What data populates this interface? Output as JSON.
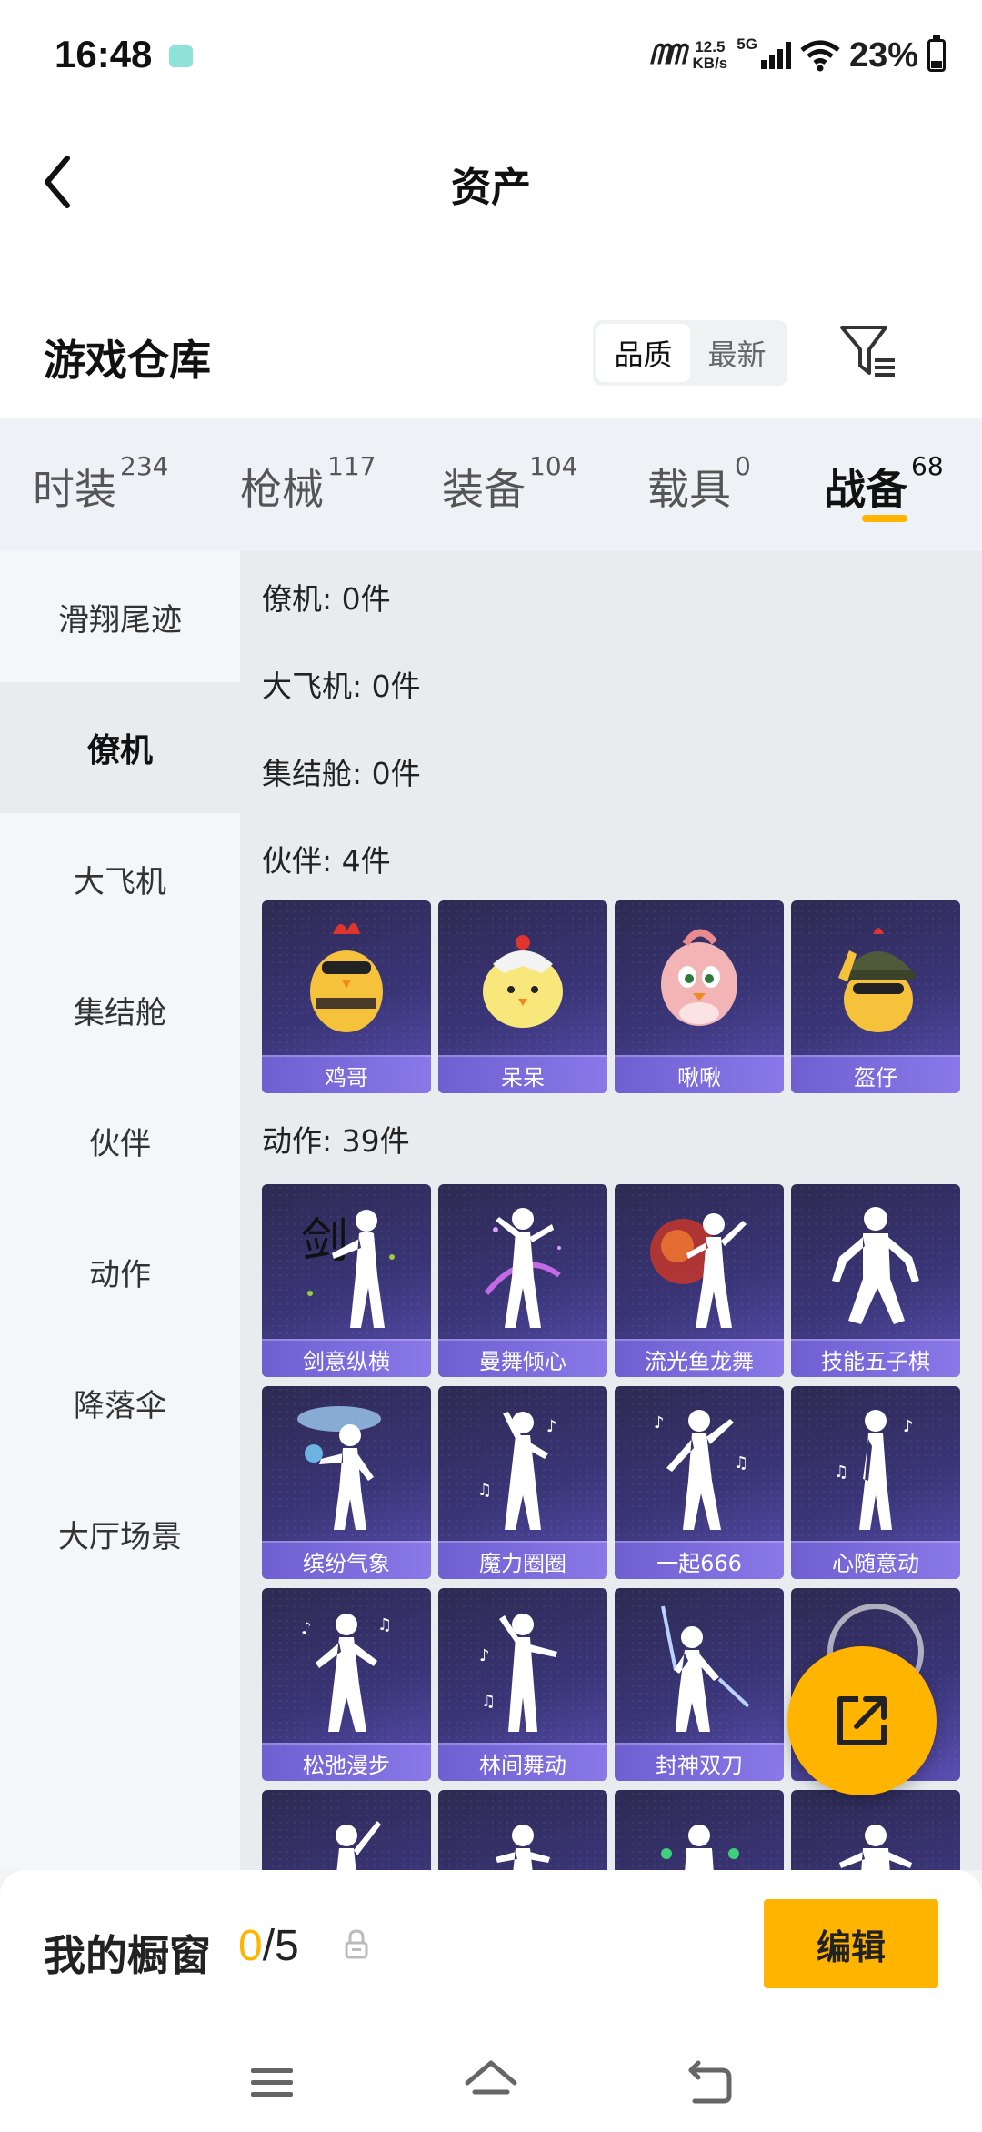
{
  "status_bar": {
    "time": "16:48",
    "network_brand": "ᗰᗰ",
    "speed_value": "12.5",
    "speed_unit": "KB/s",
    "network_type": "5G",
    "battery": "23%"
  },
  "header": {
    "title": "资产",
    "back_icon": "chevron-left-icon"
  },
  "warehouse": {
    "title": "游戏仓库",
    "sort_options": [
      "品质",
      "最新"
    ],
    "sort_selected": "品质",
    "filter_icon": "filter-icon"
  },
  "category_tabs": [
    {
      "label": "时装",
      "count": "234"
    },
    {
      "label": "枪械",
      "count": "117"
    },
    {
      "label": "装备",
      "count": "104"
    },
    {
      "label": "载具",
      "count": "0"
    },
    {
      "label": "战备",
      "count": "68",
      "active": true
    }
  ],
  "sidebar": {
    "items": [
      "滑翔尾迹",
      "僚机",
      "大飞机",
      "集结舱",
      "伙伴",
      "动作",
      "降落伞",
      "大厅场景"
    ],
    "active": "僚机"
  },
  "groups": {
    "wingman": "僚机: 0件",
    "plane": "大飞机: 0件",
    "pod": "集结舱: 0件",
    "partner": "伙伴: 4件",
    "emote": "动作: 39件"
  },
  "partners": [
    "鸡哥",
    "呆呆",
    "啾啾",
    "盔仔"
  ],
  "emotes": [
    "剑意纵横",
    "曼舞倾心",
    "流光鱼龙舞",
    "技能五子棋",
    "缤纷气象",
    "魔力圈圈",
    "一起666",
    "心随意动",
    "松弛漫步",
    "林间舞动",
    "封神双刀"
  ],
  "bottom": {
    "window_label": "我的橱窗",
    "window_current": "0",
    "window_sep_total": "/5",
    "edit_label": "编辑",
    "fab_icon": "share-export-icon"
  },
  "colors": {
    "accent": "#ffb400",
    "card_bg": "#3a3577",
    "card_caption": "#7a6ae0"
  }
}
